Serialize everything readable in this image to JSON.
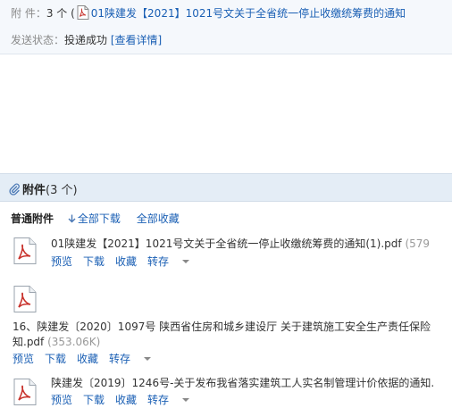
{
  "header": {
    "attachments_label": "附  件：",
    "attachments_count": "3 个 (",
    "subject": "01陕建发【2021】1021号文关于全省统一停止收缴统筹费的通知",
    "status_label": "发送状态：",
    "status_value": "投递成功",
    "details_link": "[查看详情]"
  },
  "attachments_bar": {
    "title": "附件",
    "count": "(3 个)"
  },
  "normal_section": {
    "label": "普通附件",
    "download_all": "全部下载",
    "save_all": "全部收藏"
  },
  "files": [
    {
      "name": "01陕建发【2021】1021号文关于全省统一停止收缴统筹费的通知(1).pdf",
      "size": "(579",
      "actions": {
        "preview": "预览",
        "download": "下载",
        "favorite": "收藏",
        "forward": "转存"
      }
    },
    {
      "name_line1": "16、陕建发〔2020〕1097号 陕西省住房和城乡建设厅 关于建筑施工安全生产责任保险",
      "name_line2": "知.pdf",
      "size": "(353.06K)",
      "actions": {
        "preview": "预览",
        "download": "下载",
        "favorite": "收藏",
        "forward": "转存"
      }
    },
    {
      "name": "陕建发〔2019〕1246号-关于发布我省落实建筑工人实名制管理计价依据的通知.",
      "actions": {
        "preview": "预览",
        "download": "下载",
        "favorite": "收藏",
        "forward": "转存"
      }
    }
  ],
  "colors": {
    "link": "#1a5fb4",
    "attachments_bar_bg": "#e4edf6",
    "header_bg": "#f5f8fc",
    "pdf_red": "#c8322c"
  },
  "icons": [
    "pdf-file-icon",
    "paperclip-icon",
    "download-arrow-icon",
    "dropdown-caret-icon"
  ]
}
